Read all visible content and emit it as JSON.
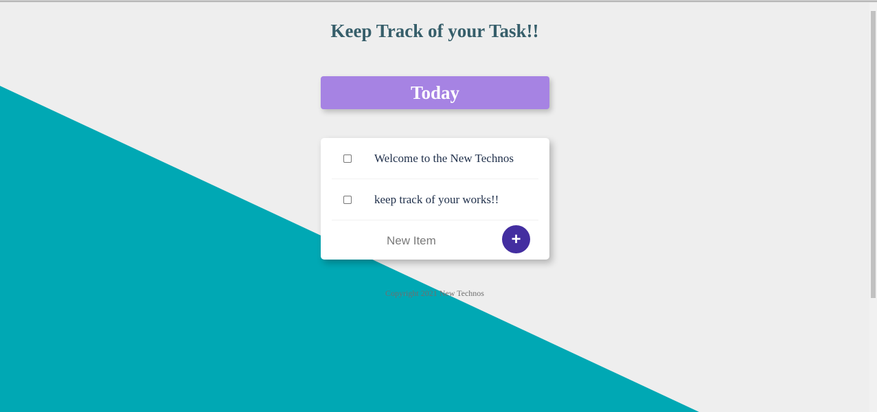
{
  "page": {
    "title": "Keep Track of your Task!!"
  },
  "list": {
    "heading": "Today",
    "items": [
      {
        "label": "Welcome to the New Technos",
        "checked": false
      },
      {
        "label": "keep track of your works!!",
        "checked": false
      }
    ],
    "new_item": {
      "placeholder": "New Item",
      "value": "",
      "add_button_label": "+"
    }
  },
  "footer": {
    "text": "Copyright 2021 New Technos"
  },
  "colors": {
    "background": "#eeeeee",
    "triangle": "#00a8b4",
    "title": "#365e6a",
    "heading_box": "#a683e3",
    "add_button": "#432ea0"
  }
}
